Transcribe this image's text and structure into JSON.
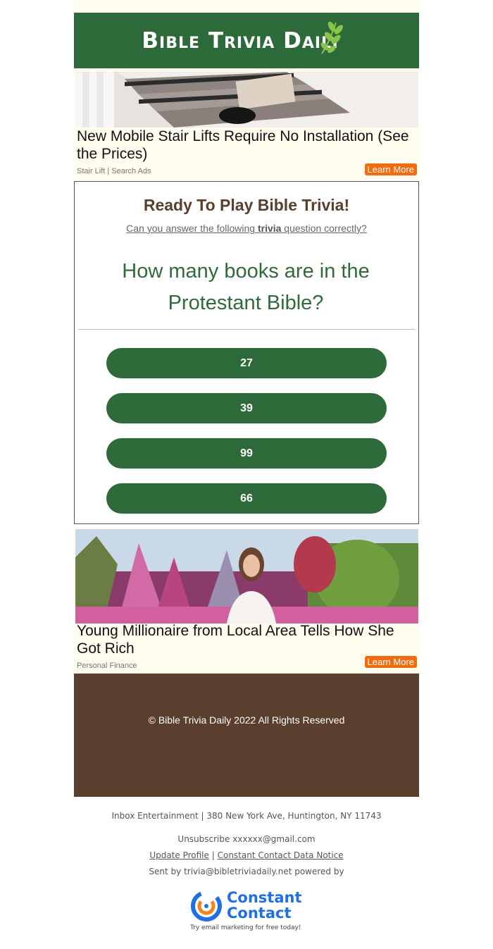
{
  "header": {
    "brand": "Bible Trivia Daily"
  },
  "ads": [
    {
      "title": "New Mobile Stair Lifts Require No Installation (See the Prices)",
      "source": "Stair Lift | Search Ads",
      "cta": "Learn More"
    },
    {
      "title": "Young Millionaire from Local Area Tells How She Got Rich",
      "source": "Personal Finance",
      "cta": "Learn More"
    }
  ],
  "quiz": {
    "title": "Ready To Play Bible Trivia!",
    "subtitle_pre": "Can you answer the following ",
    "subtitle_bold": "trivia",
    "subtitle_post": " question correctly?",
    "question": "How many books are in the Protestant Bible?",
    "answers": [
      "27",
      "39",
      "99",
      "66"
    ]
  },
  "footer": {
    "copyright": "© Bible Trivia Daily 2022 All Rights Reserved",
    "address": "Inbox Entertainment | 380 New York Ave, Huntington, NY 11743",
    "unsubscribe": "Unsubscribe xxxxxx@gmail.com",
    "update_profile": "Update Profile",
    "separator": "|",
    "data_notice": "Constant Contact Data Notice",
    "sent_by": "Sent by trivia@bibletriviadaily.net powered by",
    "cc_logo": "Constant Contact",
    "cc_tagline": "Try email marketing for free today!"
  },
  "colors": {
    "green": "#2d6a3a",
    "brown": "#5a3e2e",
    "orange": "#f26b0f",
    "cc_blue": "#1f6fe5"
  }
}
